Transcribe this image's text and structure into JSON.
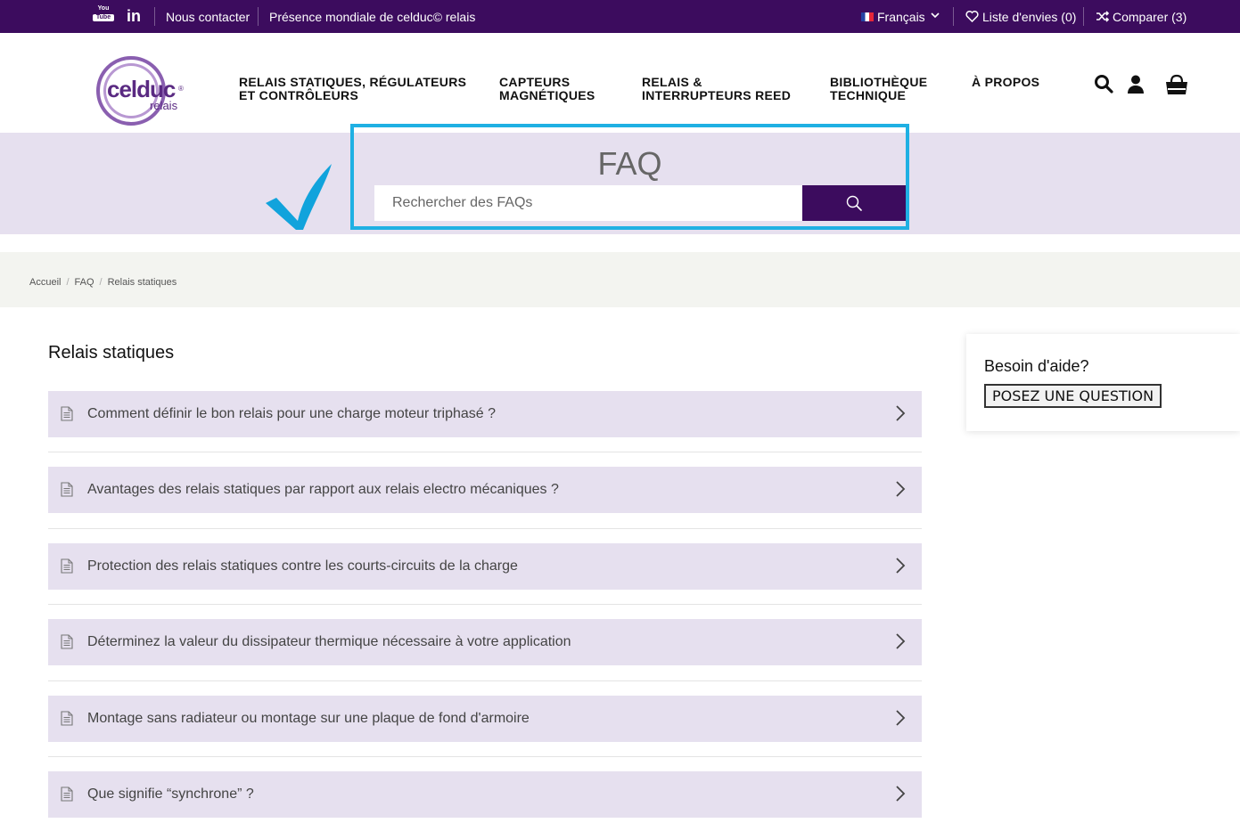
{
  "topbar": {
    "youtube_line1": "You",
    "youtube_line2": "Tube",
    "linkedin": "in",
    "contact": "Nous contacter",
    "presence": "Présence mondiale de celduc© relais",
    "language": "Français",
    "wishlist": "Liste d'envies (0)",
    "compare": "Comparer (3)"
  },
  "logo": {
    "name": "celduc",
    "sub": "relais",
    "reg": "®"
  },
  "nav": {
    "item1_line1": "RELAIS STATIQUES, RÉGULATEURS",
    "item1_line2": "ET CONTRÔLEURS",
    "item2_line1": "CAPTEURS",
    "item2_line2": "MAGNÉTIQUES",
    "item3_line1": "RELAIS &",
    "item3_line2": "INTERRUPTEURS REED",
    "item4_line1": "BIBLIOTHÈQUE",
    "item4_line2": "TECHNIQUE",
    "item5": "À PROPOS"
  },
  "icons": {
    "search": "search-icon",
    "account": "user-icon",
    "cart": "shopping-bag-icon"
  },
  "banner": {
    "title": "FAQ",
    "search_placeholder": "Rechercher des FAQs"
  },
  "breadcrumb": {
    "home": "Accueil",
    "faq": "FAQ",
    "current": "Relais statiques"
  },
  "section": {
    "title": "Relais statiques"
  },
  "faqs": [
    "Comment définir le bon relais pour une charge moteur triphasé ?",
    "Avantages des relais statiques par rapport aux relais electro mécaniques ?",
    "Protection des relais statiques contre les courts-circuits de la charge",
    "Déterminez la valeur du dissipateur thermique nécessaire à votre application",
    "Montage sans radiateur ou montage sur une plaque de fond d'armoire",
    "Que signifie “synchrone” ?"
  ],
  "help": {
    "title": "Besoin d'aide?",
    "button": "POSEZ UNE QUESTION"
  },
  "colors": {
    "primary": "#3c0c5e",
    "banner": "#e6e0ef",
    "highlight": "#1fb0e3"
  }
}
